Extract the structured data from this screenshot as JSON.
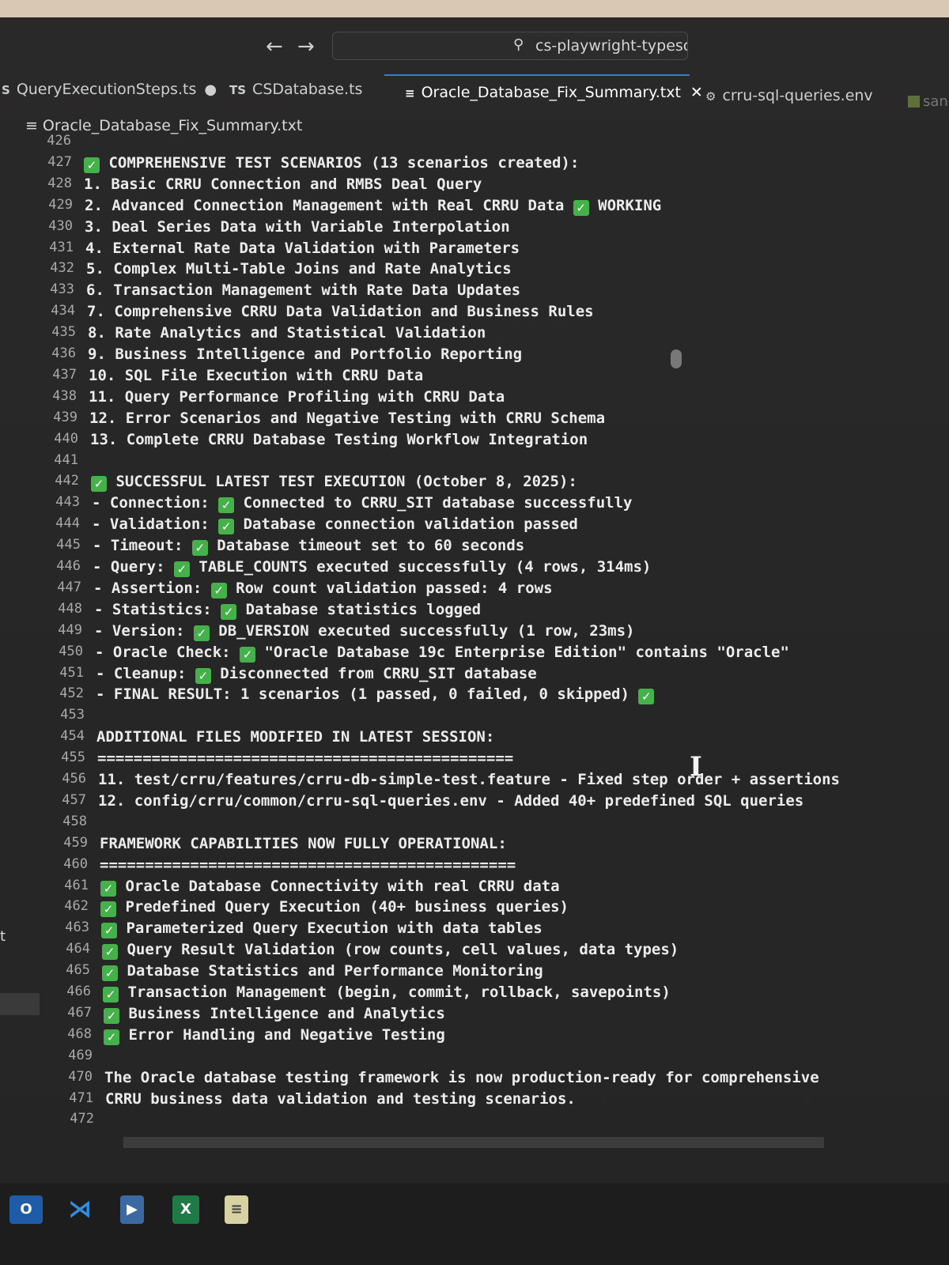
{
  "window": {
    "command_center": "cs-playwright-typescript-framework [Administrator]",
    "back_glyph": "←",
    "forward_glyph": "→"
  },
  "tabs": [
    {
      "label": "QueryExecutionSteps.ts",
      "icon_text": "S",
      "modified": "●"
    },
    {
      "label": "CSDatabase.ts",
      "icon_text": "TS"
    },
    {
      "label": "Oracle_Database_Fix_Summary.txt",
      "icon_text": "≡",
      "close": "✕"
    },
    {
      "label": "crru-sql-queries.env",
      "icon_text": "⚙"
    },
    {
      "label": "san",
      "icon_text": ""
    }
  ],
  "breadcrumb": {
    "icon_text": "≡",
    "file": "Oracle_Database_Fix_Summary.txt"
  },
  "check_glyph": "✓",
  "lines": [
    {
      "n": "426",
      "t": ""
    },
    {
      "n": "427",
      "pre": "",
      "t": " COMPREHENSIVE TEST SCENARIOS (13 scenarios created):",
      "check": true
    },
    {
      "n": "428",
      "t": "1. Basic CRRU Connection and RMBS Deal Query"
    },
    {
      "n": "429",
      "t": "2. Advanced Connection Management with Real CRRU Data ",
      "post": " WORKING"
    },
    {
      "n": "430",
      "t": "3. Deal Series Data with Variable Interpolation"
    },
    {
      "n": "431",
      "t": "4. External Rate Data Validation with Parameters"
    },
    {
      "n": "432",
      "t": "5. Complex Multi-Table Joins and Rate Analytics"
    },
    {
      "n": "433",
      "t": "6. Transaction Management with Rate Data Updates"
    },
    {
      "n": "434",
      "t": "7. Comprehensive CRRU Data Validation and Business Rules"
    },
    {
      "n": "435",
      "t": "8. Rate Analytics and Statistical Validation"
    },
    {
      "n": "436",
      "t": "9. Business Intelligence and Portfolio Reporting"
    },
    {
      "n": "437",
      "t": "10. SQL File Execution with CRRU Data"
    },
    {
      "n": "438",
      "t": "11. Query Performance Profiling with CRRU Data"
    },
    {
      "n": "439",
      "t": "12. Error Scenarios and Negative Testing with CRRU Schema"
    },
    {
      "n": "440",
      "t": "13. Complete CRRU Database Testing Workflow Integration"
    },
    {
      "n": "441",
      "t": ""
    },
    {
      "n": "442",
      "pre": "",
      "t": " SUCCESSFUL LATEST TEST EXECUTION (October 8, 2025):",
      "check": true
    },
    {
      "n": "443",
      "pre": "- Connection: ",
      "t": " Connected to CRRU_SIT database successfully",
      "check": true
    },
    {
      "n": "444",
      "pre": "- Validation: ",
      "t": " Database connection validation passed",
      "check": true
    },
    {
      "n": "445",
      "pre": "- Timeout: ",
      "t": " Database timeout set to 60 seconds",
      "check": true
    },
    {
      "n": "446",
      "pre": "- Query: ",
      "t": " TABLE_COUNTS executed successfully (4 rows, 314ms)",
      "check": true
    },
    {
      "n": "447",
      "pre": "- Assertion: ",
      "t": " Row count validation passed: 4 rows",
      "check": true
    },
    {
      "n": "448",
      "pre": "- Statistics: ",
      "t": " Database statistics logged",
      "check": true
    },
    {
      "n": "449",
      "pre": "- Version: ",
      "t": " DB_VERSION executed successfully (1 row, 23ms)",
      "check": true
    },
    {
      "n": "450",
      "pre": "- Oracle Check: ",
      "t": " \"Oracle Database 19c Enterprise Edition\" contains \"Oracle\"",
      "check": true
    },
    {
      "n": "451",
      "pre": "- Cleanup: ",
      "t": " Disconnected from CRRU_SIT database",
      "check": true
    },
    {
      "n": "452",
      "t": "- FINAL RESULT: 1 scenarios (1 passed, 0 failed, 0 skipped) ",
      "tailcheck": true
    },
    {
      "n": "453",
      "t": ""
    },
    {
      "n": "454",
      "t": "ADDITIONAL FILES MODIFIED IN LATEST SESSION:"
    },
    {
      "n": "455",
      "t": "=============================================="
    },
    {
      "n": "456",
      "t": "11. test/crru/features/crru-db-simple-test.feature - Fixed step order + assertions"
    },
    {
      "n": "457",
      "t": "12. config/crru/common/crru-sql-queries.env - Added 40+ predefined SQL queries"
    },
    {
      "n": "458",
      "t": ""
    },
    {
      "n": "459",
      "t": "FRAMEWORK CAPABILITIES NOW FULLY OPERATIONAL:"
    },
    {
      "n": "460",
      "t": "=============================================="
    },
    {
      "n": "461",
      "pre": "",
      "t": " Oracle Database Connectivity with real CRRU data",
      "check": true
    },
    {
      "n": "462",
      "pre": "",
      "t": " Predefined Query Execution (40+ business queries)",
      "check": true
    },
    {
      "n": "463",
      "pre": "",
      "t": " Parameterized Query Execution with data tables",
      "check": true
    },
    {
      "n": "464",
      "pre": "",
      "t": " Query Result Validation (row counts, cell values, data types)",
      "check": true
    },
    {
      "n": "465",
      "pre": "",
      "t": " Database Statistics and Performance Monitoring",
      "check": true
    },
    {
      "n": "466",
      "pre": "",
      "t": " Transaction Management (begin, commit, rollback, savepoints)",
      "check": true
    },
    {
      "n": "467",
      "pre": "",
      "t": " Business Intelligence and Analytics",
      "check": true
    },
    {
      "n": "468",
      "pre": "",
      "t": " Error Handling and Negative Testing",
      "check": true
    },
    {
      "n": "469",
      "t": ""
    },
    {
      "n": "470",
      "t": "The Oracle database testing framework is now production-ready for comprehensive"
    },
    {
      "n": "471",
      "t": "CRRU business data validation and testing scenarios."
    },
    {
      "n": "472",
      "t": ""
    }
  ],
  "left_edge_char": "t",
  "taskbar": {
    "outlook": "O",
    "vscode": "⋊",
    "webex": "▶",
    "excel": "X",
    "notepad": "≡"
  }
}
